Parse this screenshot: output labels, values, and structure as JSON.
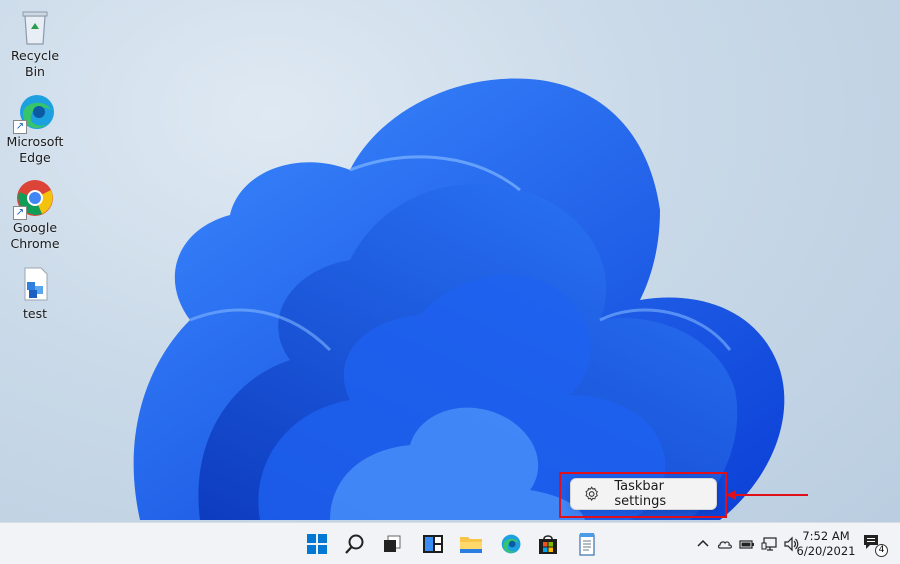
{
  "desktop": {
    "icons": [
      {
        "label": "Recycle Bin"
      },
      {
        "label": "Microsoft Edge"
      },
      {
        "label": "Google Chrome"
      },
      {
        "label": "test"
      }
    ]
  },
  "context_menu": {
    "item_label": "Taskbar settings",
    "icon": "gear-icon"
  },
  "taskbar": {
    "apps": [
      "start-icon",
      "search-icon",
      "task-view-icon",
      "widgets-icon",
      "file-explorer-icon",
      "edge-icon",
      "store-icon",
      "notepad-icon"
    ],
    "tray_icons": [
      "chevron-up-icon",
      "onedrive-icon",
      "battery-icon",
      "network-icon",
      "volume-icon"
    ],
    "clock": {
      "time": "7:52 AM",
      "date": "6/20/2021"
    },
    "notification_count": "4"
  },
  "colors": {
    "accent": "#0078d4",
    "highlight": "#e0101a",
    "taskbar_bg": "#f1f3f6"
  }
}
